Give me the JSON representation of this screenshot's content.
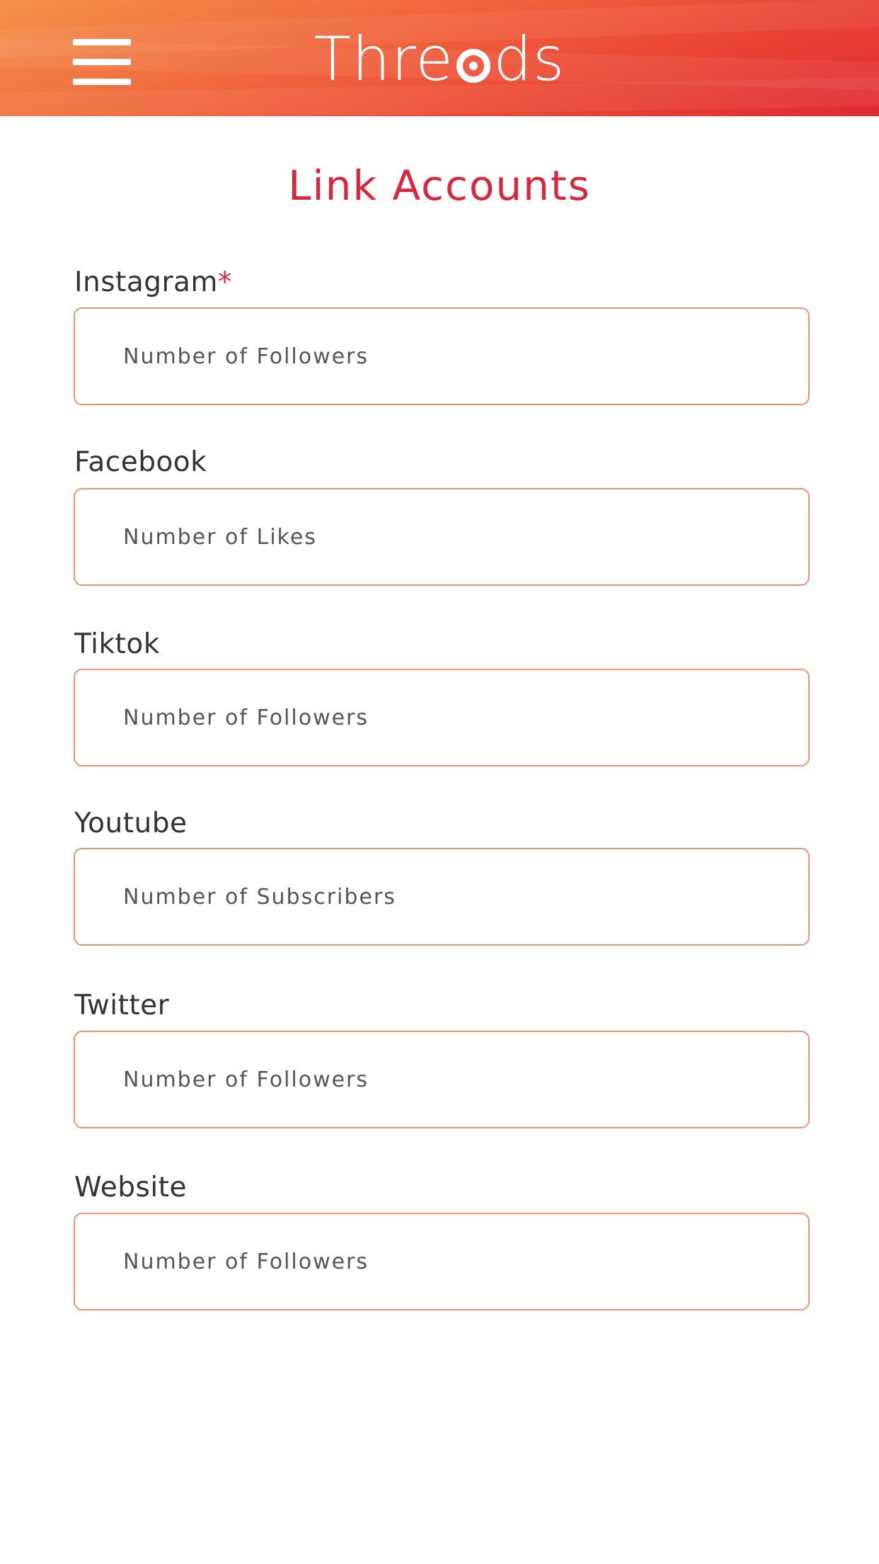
{
  "header": {
    "logo_prefix": "Thre",
    "logo_suffix": "ds",
    "menu_icon": "hamburger-menu-icon",
    "logo_a_icon": "at-sign-icon",
    "gradient_colors": [
      "#f5924a",
      "#f06a3e",
      "#ec4a36",
      "#e12a30"
    ]
  },
  "page": {
    "title": "Link Accounts",
    "title_color": "#d9263a",
    "required_marker": "*"
  },
  "fields": [
    {
      "label": "Instagram",
      "required": true,
      "placeholder": "Number of Followers",
      "value": ""
    },
    {
      "label": "Facebook",
      "required": false,
      "placeholder": "Number of Likes",
      "value": ""
    },
    {
      "label": "Tiktok",
      "required": false,
      "placeholder": "Number of Followers",
      "value": ""
    },
    {
      "label": "Youtube",
      "required": false,
      "placeholder": "Number of Subscribers",
      "value": ""
    },
    {
      "label": "Twitter",
      "required": false,
      "placeholder": "Number of Followers",
      "value": ""
    },
    {
      "label": "Website",
      "required": false,
      "placeholder": "Number of Followers",
      "value": ""
    }
  ],
  "colors": {
    "field_border": "#f0936a",
    "label_text": "#333333",
    "placeholder_text": "#555555"
  }
}
